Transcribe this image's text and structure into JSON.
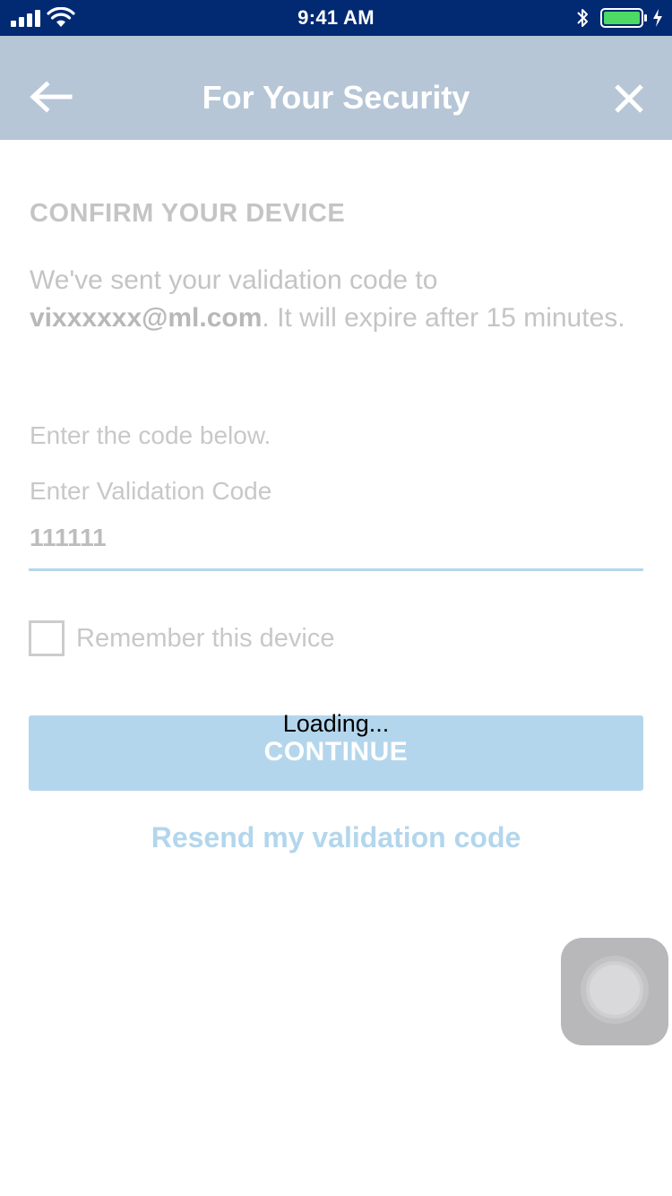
{
  "status_bar": {
    "time": "9:41 AM",
    "icons": [
      "cellular-signal-icon",
      "wifi-icon",
      "bluetooth-icon",
      "battery-icon",
      "charging-bolt-icon"
    ],
    "battery_color": "#4cd964"
  },
  "nav": {
    "title": "For Your Security",
    "back_icon": "arrow-left-icon",
    "close_icon": "close-icon",
    "background": "#b6c6d6"
  },
  "content": {
    "heading": "CONFIRM YOUR DEVICE",
    "message_prefix": "We've sent your validation code to",
    "email": "vixxxxxx@ml.com",
    "message_suffix": ". It will expire after 15 minutes.",
    "instruction": "Enter the code below.",
    "code_field": {
      "label": "Enter Validation Code",
      "value": "111111"
    },
    "remember_device": {
      "label": "Remember this device",
      "checked": false
    },
    "continue_button": "CONTINUE",
    "loading_text": "Loading...",
    "resend_link": "Resend my validation code",
    "accent_color": "#b3d6ec"
  },
  "assistive_touch": {
    "icon": "assistive-touch-icon"
  }
}
